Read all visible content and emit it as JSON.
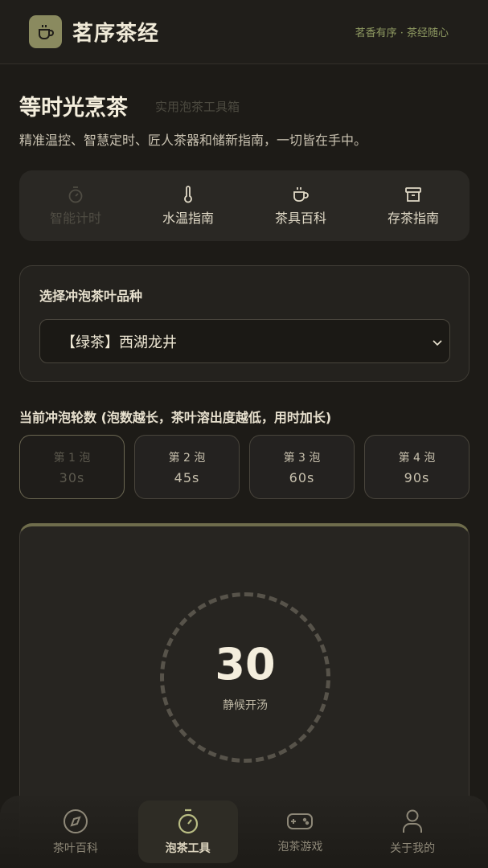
{
  "header": {
    "title": "茗序茶经",
    "slogan": "茗香有序 · 茶经随心",
    "logo_icon": "tea-cup-icon"
  },
  "page": {
    "title": "等时光烹茶",
    "subtitle": "实用泡茶工具箱",
    "description": "精准温控、智慧定时、匠人茶器和储新指南，一切皆在手中。"
  },
  "tabs": [
    {
      "label": "智能计时",
      "icon": "stopwatch-icon",
      "active": true
    },
    {
      "label": "水温指南",
      "icon": "thermometer-icon",
      "active": false
    },
    {
      "label": "茶具百科",
      "icon": "cup-icon",
      "active": false
    },
    {
      "label": "存茶指南",
      "icon": "archive-box-icon",
      "active": false
    }
  ],
  "tea_select": {
    "label": "选择冲泡茶叶品种",
    "value": "【绿茶】西湖龙井"
  },
  "rounds": {
    "label": "当前冲泡轮数 (泡数越长，茶叶溶出度越低，用时加长)",
    "items": [
      {
        "name": "第 1 泡",
        "time": "30s",
        "active": true
      },
      {
        "name": "第 2 泡",
        "time": "45s",
        "active": false
      },
      {
        "name": "第 3 泡",
        "time": "60s",
        "active": false
      },
      {
        "name": "第 4 泡",
        "time": "90s",
        "active": false
      }
    ]
  },
  "timer": {
    "value": "30",
    "status": "静候开汤"
  },
  "bottom_nav": [
    {
      "label": "茶叶百科",
      "icon": "compass-icon",
      "active": false
    },
    {
      "label": "泡茶工具",
      "icon": "stopwatch-icon",
      "active": true
    },
    {
      "label": "泡茶游戏",
      "icon": "gamepad-icon",
      "active": false
    },
    {
      "label": "关于我的",
      "icon": "user-icon",
      "active": false
    }
  ],
  "colors": {
    "background": "#1d1b17",
    "accent": "#8a8a5f",
    "slogan": "#8f9a62"
  }
}
